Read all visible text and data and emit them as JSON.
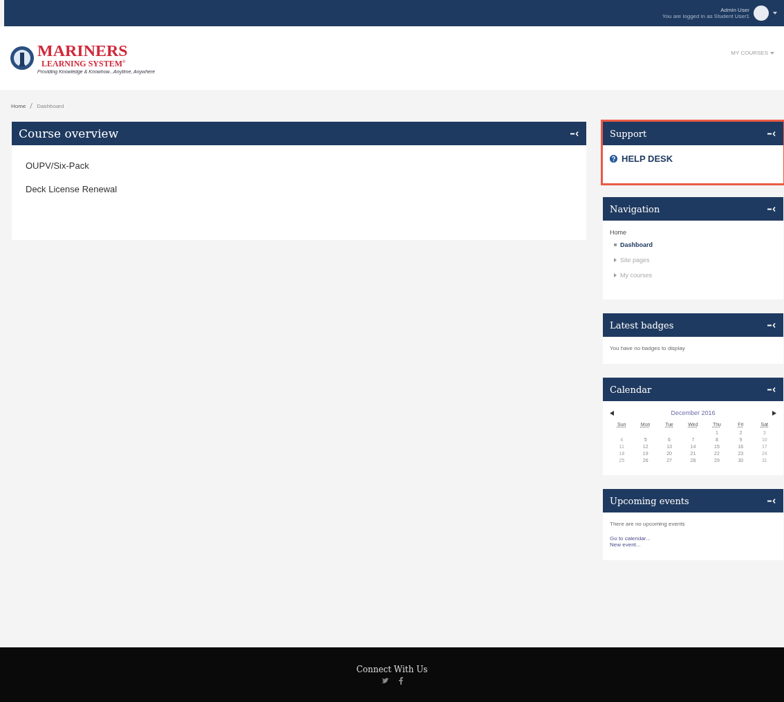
{
  "top_bar": {
    "user_name": "Admin User",
    "login_info": "You are logged in as Student User1"
  },
  "logo": {
    "title": "MARINERS",
    "subtitle": "LEARNING SYSTEM",
    "trademark": "®",
    "tagline": "Providing Knowledge & Knowhow...Anytime, Anywhere"
  },
  "nav_menu": {
    "label": "MY COURSES"
  },
  "breadcrumb": [
    {
      "label": "Home"
    },
    {
      "label": "Dashboard"
    }
  ],
  "course_overview": {
    "title": "Course overview",
    "courses": [
      "OUPV/Six-Pack",
      "Deck License Renewal"
    ]
  },
  "blocks": [
    {
      "kind": "support",
      "title": "Support",
      "highlighted": true,
      "link": "HELP DESK"
    },
    {
      "kind": "navigation",
      "title": "Navigation",
      "root": "Home",
      "items": [
        {
          "label": "Dashboard",
          "selected": true,
          "expandable": false
        },
        {
          "label": "Site pages",
          "selected": false,
          "expandable": true
        },
        {
          "label": "My courses",
          "selected": false,
          "expandable": true
        }
      ]
    },
    {
      "kind": "text",
      "title": "Latest badges",
      "text": "You have no badges to display"
    },
    {
      "kind": "calendar",
      "title": "Calendar",
      "month": "December 2016",
      "weekdays": [
        "Sun",
        "Mon",
        "Tue",
        "Wed",
        "Thu",
        "Fri",
        "Sat"
      ],
      "weeks": [
        {
          "days": [
            "1",
            "2",
            "3"
          ]
        },
        {
          "days": [
            "4",
            "5",
            "6",
            "7",
            "8",
            "9",
            "10"
          ]
        },
        {
          "days": [
            "11",
            "12",
            "13",
            "14",
            "15",
            "16",
            "17"
          ]
        },
        {
          "days": [
            "18",
            "19",
            "20",
            "21",
            "22",
            "23",
            "24"
          ]
        },
        {
          "days": [
            "25",
            "26",
            "27",
            "28",
            "29",
            "30",
            "31"
          ]
        }
      ]
    },
    {
      "kind": "events",
      "title": "Upcoming events",
      "text": "There are no upcoming events",
      "links": [
        "Go to calendar...",
        "New event..."
      ]
    }
  ],
  "footer": {
    "title": "Connect With Us"
  }
}
